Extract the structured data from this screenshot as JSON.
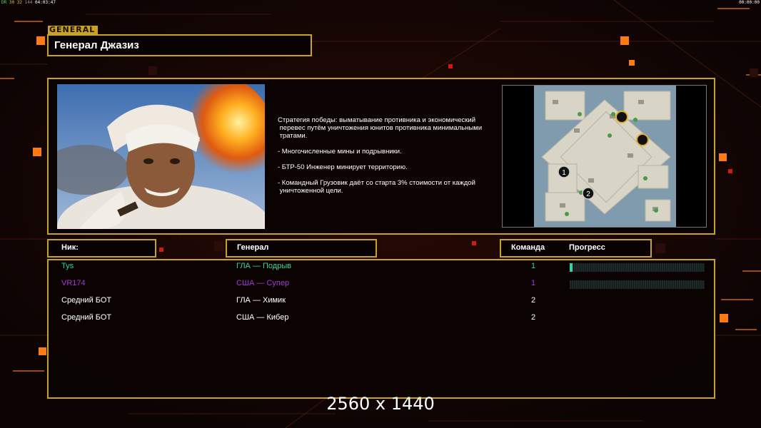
{
  "hud": {
    "stats": [
      "DR",
      "30",
      "32",
      "144",
      "04:03:47"
    ],
    "clock": "00:00:00"
  },
  "header": {
    "tab_label": "GENERAL",
    "title": "Генерал Джазиз"
  },
  "description": [
    "Стратегия победы: выматывание противника и экономический\n перевес путём уничтожения юнитов противника минимальными\n тратами.",
    "- Многочисленные мины и подрывники.",
    "- БТР-50 Инженер минирует территорию.",
    "- Командный Грузовик даёт со старта 3% стоимости от каждой\n уничтоженной цели."
  ],
  "map": {
    "start_markers": [
      "1",
      "2"
    ]
  },
  "columns": {
    "nick": "Ник:",
    "general": "Генерал",
    "team": "Команда",
    "progress": "Прогресс"
  },
  "players": [
    {
      "nick": "Tys",
      "general": "ГЛА — Подрыв",
      "team": "1",
      "progress": 0.02,
      "color": "#2fd6a0",
      "show_progress": true
    },
    {
      "nick": "VR174",
      "general": "США — Супер",
      "team": "1",
      "progress": 0,
      "color": "#a23ad6",
      "show_progress": true
    },
    {
      "nick": "Средний БОТ",
      "general": "ГЛА — Химик",
      "team": "2",
      "progress": 0,
      "color": "#ffffff",
      "show_progress": false
    },
    {
      "nick": "Средний БОТ",
      "general": "США — Кибер",
      "team": "2",
      "progress": 0,
      "color": "#ffffff",
      "show_progress": false
    }
  ],
  "resolution_label": "2560 x 1440",
  "colors": {
    "accent": "#c9a223",
    "background": "#0b0403",
    "orange": "#ff8a1a"
  }
}
